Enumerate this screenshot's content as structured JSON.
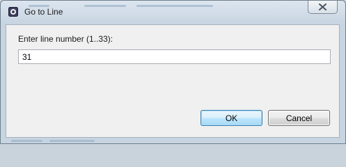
{
  "window": {
    "title": "Go to Line",
    "icon": "eclipse-icon",
    "close_label": "Close"
  },
  "dialog": {
    "prompt": "Enter line number (1..33):",
    "line_input": {
      "value": "31",
      "placeholder": ""
    },
    "ok_label": "OK",
    "cancel_label": "Cancel"
  },
  "colors": {
    "titlebar": "#c7d4e1",
    "client_background": "#f0f0f0",
    "default_button_border": "#3c7fb1"
  }
}
